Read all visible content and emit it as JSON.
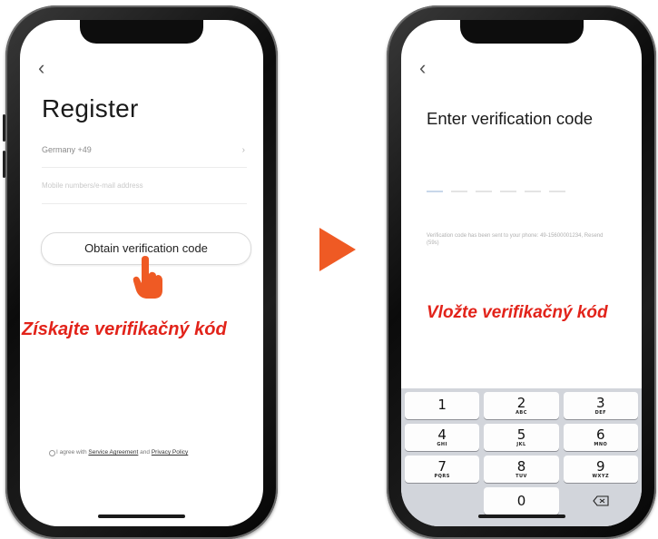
{
  "left_screen": {
    "back_glyph": "‹",
    "title": "Register",
    "country_value": "Germany +49",
    "account_placeholder": "Mobile numbers/e-mail address",
    "obtain_button_label": "Obtain verification code",
    "caption": "Získajte verifikačný kód",
    "agreement_prefix": "I agree with ",
    "service_agreement_link": "Service Agreement",
    "agreement_and": " and ",
    "privacy_policy_link": "Privacy Policy"
  },
  "right_screen": {
    "back_glyph": "‹",
    "title": "Enter verification code",
    "sent_note": "Verification code has been sent to your phone: 49-15600001234, Resend (59s)",
    "caption": "Vložte verifikačný kód",
    "keypad": {
      "keys": [
        {
          "num": "1",
          "letters": ""
        },
        {
          "num": "2",
          "letters": "ABC"
        },
        {
          "num": "3",
          "letters": "DEF"
        },
        {
          "num": "4",
          "letters": "GHI"
        },
        {
          "num": "5",
          "letters": "JKL"
        },
        {
          "num": "6",
          "letters": "MNO"
        },
        {
          "num": "7",
          "letters": "PQRS"
        },
        {
          "num": "8",
          "letters": "TUV"
        },
        {
          "num": "9",
          "letters": "WXYZ"
        },
        {
          "num": "0",
          "letters": ""
        }
      ],
      "delete_icon": "backspace-icon"
    }
  },
  "colors": {
    "accent_red": "#e2231a",
    "arrow_orange": "#ef5a24",
    "phone_body": "#111111",
    "keypad_bg": "#d2d5db"
  },
  "icons": {
    "hand": "pointing-hand-icon",
    "arrow": "play-arrow-icon"
  }
}
